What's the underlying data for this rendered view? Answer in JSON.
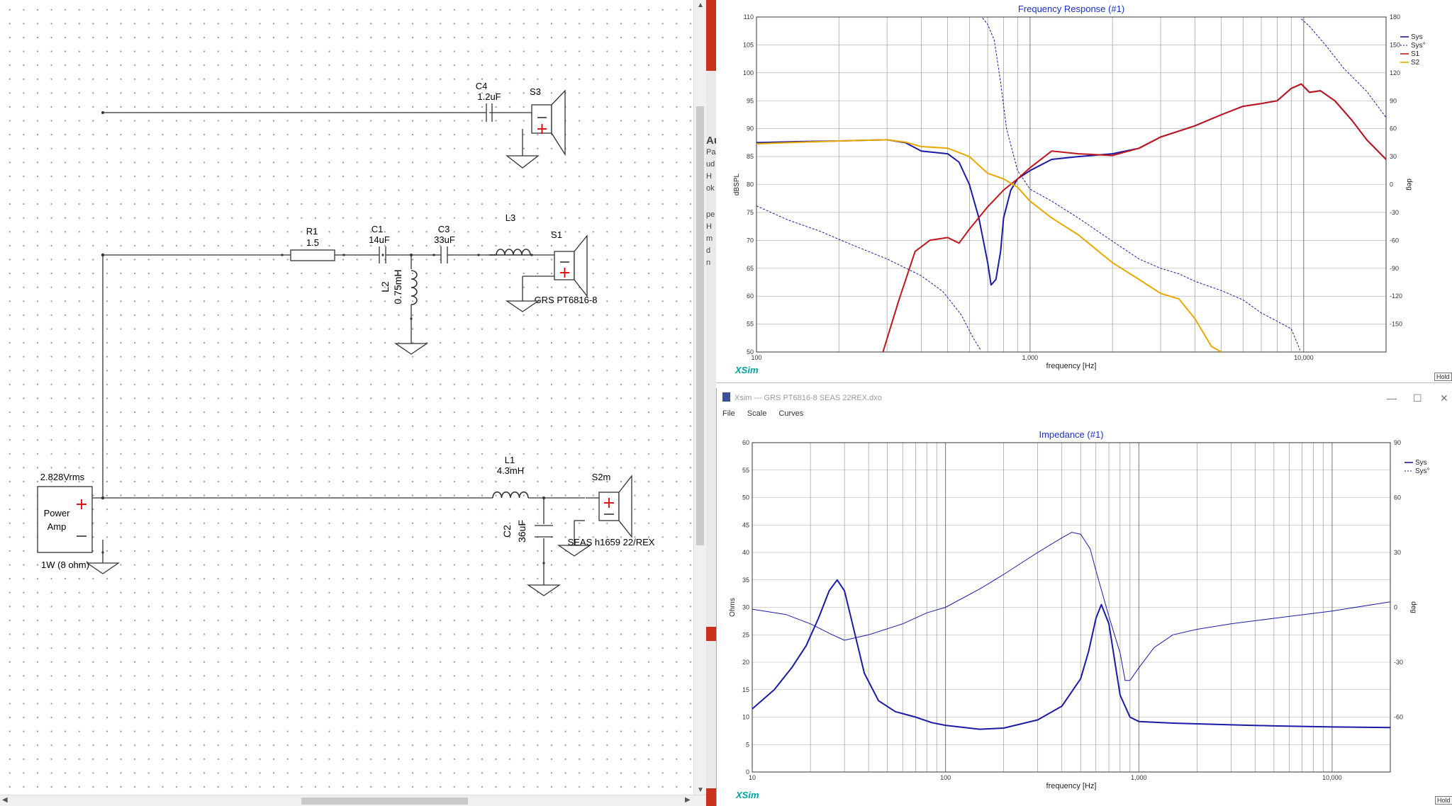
{
  "schematic": {
    "source": {
      "voltage": "2.828Vrms",
      "name_line1": "Power",
      "name_line2": "Amp",
      "power": "1W (8 ohm)"
    },
    "C4": {
      "name": "C4",
      "value": "1.2uF"
    },
    "S3": {
      "name": "S3"
    },
    "R1": {
      "name": "R1",
      "value": "1.5"
    },
    "C1": {
      "name": "C1",
      "value": "14uF"
    },
    "C3": {
      "name": "C3",
      "value": "33uF"
    },
    "L3": {
      "name": "L3"
    },
    "L2": {
      "name": "L2",
      "value": "0.75mH"
    },
    "S1": {
      "name": "S1",
      "model": "GRS PT6816-8"
    },
    "L1": {
      "name": "L1",
      "value": "4.3mH"
    },
    "C2": {
      "name": "C2",
      "value": "36uF"
    },
    "S2m": {
      "name": "S2m",
      "model": "SEAS h1659 22/REX"
    }
  },
  "background_app": {
    "partial_texts": [
      "Au",
      "Pa",
      "ud",
      "H",
      "ok",
      "pe",
      "H",
      "m",
      "d n"
    ]
  },
  "freq_window": {
    "logo": "XSim",
    "hold_label": "Hold",
    "chart_data": {
      "type": "line",
      "title": "Frequency Response (#1)",
      "xlabel": "frequency [Hz]",
      "ylabel": "dBSPL",
      "y2label": "deg",
      "x_scale": "log",
      "xlim": [
        100,
        20000
      ],
      "ylim": [
        50,
        110
      ],
      "y2lim": [
        -180,
        180
      ],
      "x_tick_labels": [
        "100",
        "1,000",
        "10,000"
      ],
      "y_ticks": [
        "50",
        "55",
        "60",
        "65",
        "70",
        "75",
        "80",
        "85",
        "90",
        "95",
        "100",
        "105",
        "110"
      ],
      "y2_ticks": [
        "-150",
        "-120",
        "-90",
        "-60",
        "-30",
        "0",
        "30",
        "60",
        "90",
        "120",
        "150",
        "180"
      ],
      "grid": true,
      "legend_position": "top-right",
      "legend": [
        {
          "name": "Sys",
          "color": "#1a1aa6",
          "style": "solid"
        },
        {
          "name": "Sys°",
          "color": "#1a1aa6",
          "style": "dashed"
        },
        {
          "name": "S1",
          "color": "#c0171c",
          "style": "solid"
        },
        {
          "name": "S2",
          "color": "#e8a800",
          "style": "solid"
        }
      ],
      "series": [
        {
          "name": "Sys",
          "axis": "left",
          "color": "#1a1aa6",
          "width": 2,
          "dash": false,
          "points": [
            [
              100,
              87.5
            ],
            [
              150,
              87.7
            ],
            [
              200,
              87.8
            ],
            [
              300,
              88
            ],
            [
              350,
              87.5
            ],
            [
              400,
              86
            ],
            [
              500,
              85.5
            ],
            [
              550,
              84
            ],
            [
              600,
              80
            ],
            [
              650,
              74
            ],
            [
              700,
              66
            ],
            [
              720,
              62
            ],
            [
              750,
              63
            ],
            [
              780,
              68
            ],
            [
              800,
              74
            ],
            [
              850,
              79
            ],
            [
              900,
              81
            ],
            [
              1000,
              82.5
            ],
            [
              1200,
              84.5
            ],
            [
              1500,
              85
            ],
            [
              2000,
              85.5
            ],
            [
              2500,
              86.5
            ],
            [
              3000,
              88.5
            ],
            [
              4000,
              90.5
            ],
            [
              5000,
              92.5
            ],
            [
              6000,
              94
            ],
            [
              7000,
              94.5
            ],
            [
              8000,
              95
            ],
            [
              9000,
              97.2
            ],
            [
              9800,
              98
            ],
            [
              10500,
              96.5
            ],
            [
              11500,
              96.8
            ],
            [
              13000,
              95
            ],
            [
              15000,
              91.5
            ],
            [
              17000,
              88
            ],
            [
              20000,
              84.5
            ]
          ]
        },
        {
          "name": "Sys°",
          "axis": "right",
          "color": "#1a1aa6",
          "width": 1,
          "dash": true,
          "points": [
            [
              100,
              -23
            ],
            [
              130,
              -38
            ],
            [
              170,
              -50
            ],
            [
              220,
              -64
            ],
            [
              300,
              -80
            ],
            [
              400,
              -98
            ],
            [
              480,
              -115
            ],
            [
              560,
              -140
            ],
            [
              620,
              -165
            ],
            [
              660,
              -178
            ],
            [
              670,
              179
            ],
            [
              700,
              172
            ],
            [
              740,
              155
            ],
            [
              780,
              110
            ],
            [
              820,
              60
            ],
            [
              900,
              15
            ],
            [
              1000,
              -5
            ],
            [
              1200,
              -18
            ],
            [
              1500,
              -36
            ],
            [
              2000,
              -61
            ],
            [
              2500,
              -80
            ],
            [
              3000,
              -90
            ],
            [
              3500,
              -96
            ],
            [
              4000,
              -104
            ],
            [
              5000,
              -114
            ],
            [
              6000,
              -124
            ],
            [
              7000,
              -138
            ],
            [
              8000,
              -147
            ],
            [
              9000,
              -155
            ],
            [
              9700,
              -178
            ],
            [
              9800,
              178
            ],
            [
              10500,
              170
            ],
            [
              12000,
              150
            ],
            [
              14000,
              125
            ],
            [
              17000,
              100
            ],
            [
              20000,
              72
            ]
          ]
        },
        {
          "name": "S1",
          "axis": "left",
          "color": "#c0171c",
          "width": 2,
          "dash": false,
          "points": [
            [
              290,
              50
            ],
            [
              330,
              59
            ],
            [
              380,
              68
            ],
            [
              430,
              70
            ],
            [
              500,
              70.5
            ],
            [
              550,
              69.5
            ],
            [
              600,
              72
            ],
            [
              700,
              76
            ],
            [
              800,
              79
            ],
            [
              900,
              81
            ],
            [
              1000,
              83
            ],
            [
              1200,
              86
            ],
            [
              1500,
              85.5
            ],
            [
              2000,
              85.2
            ],
            [
              2500,
              86.5
            ],
            [
              3000,
              88.5
            ],
            [
              4000,
              90.5
            ],
            [
              5000,
              92.5
            ],
            [
              6000,
              94
            ],
            [
              7000,
              94.5
            ],
            [
              8000,
              95
            ],
            [
              9000,
              97.2
            ],
            [
              9800,
              98
            ],
            [
              10500,
              96.5
            ],
            [
              11500,
              96.8
            ],
            [
              13000,
              95
            ],
            [
              15000,
              91.5
            ],
            [
              17000,
              88
            ],
            [
              20000,
              84.5
            ]
          ]
        },
        {
          "name": "S2",
          "axis": "left",
          "color": "#e8a800",
          "width": 2,
          "dash": false,
          "points": [
            [
              100,
              87.3
            ],
            [
              150,
              87.6
            ],
            [
              200,
              87.8
            ],
            [
              300,
              88
            ],
            [
              350,
              87.6
            ],
            [
              400,
              86.8
            ],
            [
              500,
              86.5
            ],
            [
              600,
              85
            ],
            [
              700,
              82
            ],
            [
              800,
              81
            ],
            [
              900,
              79.5
            ],
            [
              1000,
              77
            ],
            [
              1200,
              74
            ],
            [
              1500,
              71
            ],
            [
              2000,
              66
            ],
            [
              2500,
              63
            ],
            [
              3000,
              60.5
            ],
            [
              3500,
              59.5
            ],
            [
              4000,
              56
            ],
            [
              4600,
              51
            ],
            [
              5000,
              50
            ]
          ]
        }
      ]
    }
  },
  "z_window": {
    "title": "Xsim --- GRS PT6816-8 SEAS 22REX.dxo",
    "menu": [
      "File",
      "Scale",
      "Curves"
    ],
    "controls": {
      "minimize": "—",
      "maximize": "☐",
      "close": "✕"
    },
    "logo": "XSim",
    "hold_label": "Hold",
    "chart_data": {
      "type": "line",
      "title": "Impedance (#1)",
      "xlabel": "frequency [Hz]",
      "ylabel": "Ohms",
      "y2label": "deg",
      "x_scale": "log",
      "xlim": [
        10,
        20000
      ],
      "ylim": [
        0,
        60
      ],
      "y2lim": [
        -90,
        90
      ],
      "x_tick_labels": [
        "10",
        "100",
        "1,000",
        "10,000"
      ],
      "y_ticks": [
        "0",
        "5",
        "10",
        "15",
        "20",
        "25",
        "30",
        "35",
        "40",
        "45",
        "50",
        "55",
        "60"
      ],
      "y2_ticks": [
        "-60",
        "-30",
        "0",
        "30",
        "60",
        "90"
      ],
      "grid": true,
      "legend_position": "top-right",
      "legend": [
        {
          "name": "Sys",
          "color": "#1a1aa6",
          "style": "solid"
        },
        {
          "name": "Sys°",
          "color": "#1a1aa6",
          "style": "dashed"
        }
      ],
      "series": [
        {
          "name": "Sys",
          "axis": "left",
          "color": "#1a1aa6",
          "width": 2,
          "dash": false,
          "points": [
            [
              10,
              11.5
            ],
            [
              13,
              15
            ],
            [
              16,
              19
            ],
            [
              19,
              23
            ],
            [
              22,
              28
            ],
            [
              25,
              33
            ],
            [
              27.5,
              35
            ],
            [
              30,
              33
            ],
            [
              33,
              27
            ],
            [
              38,
              18
            ],
            [
              45,
              13
            ],
            [
              55,
              11
            ],
            [
              70,
              10
            ],
            [
              85,
              9
            ],
            [
              100,
              8.5
            ],
            [
              150,
              7.8
            ],
            [
              200,
              8
            ],
            [
              300,
              9.5
            ],
            [
              400,
              12
            ],
            [
              500,
              17
            ],
            [
              550,
              22
            ],
            [
              600,
              28
            ],
            [
              640,
              30.5
            ],
            [
              700,
              27
            ],
            [
              760,
              19
            ],
            [
              800,
              14
            ],
            [
              900,
              10
            ],
            [
              1000,
              9.2
            ],
            [
              1500,
              8.9
            ],
            [
              3000,
              8.6
            ],
            [
              5000,
              8.4
            ],
            [
              10000,
              8.2
            ],
            [
              20000,
              8.1
            ]
          ]
        },
        {
          "name": "Sys°",
          "axis": "right",
          "color": "#1a1aa6",
          "width": 1,
          "dash": false,
          "points": [
            [
              10,
              -1
            ],
            [
              15,
              -4
            ],
            [
              20,
              -9
            ],
            [
              26,
              -15
            ],
            [
              30,
              -18
            ],
            [
              40,
              -15
            ],
            [
              60,
              -9
            ],
            [
              80,
              -3
            ],
            [
              100,
              0
            ],
            [
              150,
              10
            ],
            [
              200,
              18
            ],
            [
              300,
              30
            ],
            [
              400,
              38
            ],
            [
              450,
              41
            ],
            [
              500,
              40
            ],
            [
              560,
              32
            ],
            [
              600,
              20
            ],
            [
              700,
              -5
            ],
            [
              800,
              -25
            ],
            [
              850,
              -40
            ],
            [
              900,
              -40
            ],
            [
              1000,
              -33
            ],
            [
              1200,
              -22
            ],
            [
              1500,
              -15
            ],
            [
              2000,
              -12
            ],
            [
              3000,
              -9
            ],
            [
              5000,
              -6
            ],
            [
              10000,
              -2
            ],
            [
              20000,
              3
            ]
          ]
        }
      ]
    }
  }
}
